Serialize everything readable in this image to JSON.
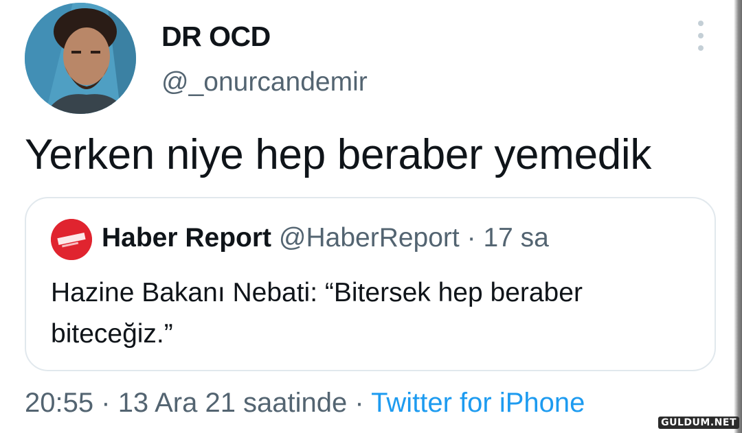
{
  "author": {
    "display_name": "DR OCD",
    "handle": "@_onurcandemir"
  },
  "tweet": {
    "text": "Yerken niye hep beraber yemedik"
  },
  "quoted_tweet": {
    "display_name": "Haber Report",
    "handle": "@HaberReport",
    "separator": "·",
    "time": "17 sa",
    "text": "Hazine Bakanı Nebati: “Bitersek hep beraber biteceğiz.”"
  },
  "footer": {
    "time": "20:55",
    "separator1": "·",
    "date": "13 Ara 21 saatinde",
    "separator2": "·",
    "source": "Twitter for iPhone"
  },
  "watermark": "GULDUM.NET",
  "icons": {
    "more": "more-vertical-icon"
  },
  "colors": {
    "secondary_text": "#536471",
    "link": "#1d9bf0",
    "quote_border": "#e1e8ed",
    "quote_avatar": "#e0242f"
  }
}
